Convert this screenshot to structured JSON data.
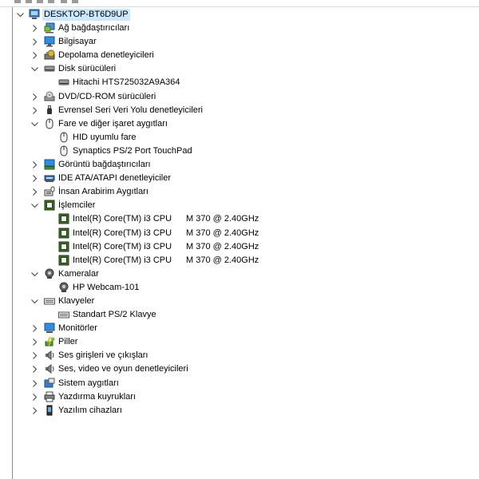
{
  "tree": {
    "root": {
      "label": "DESKTOP-BT6D9UP",
      "icon": "computer-icon"
    },
    "items": [
      {
        "label": "Ağ bağdaştırıcıları",
        "icon": "network-adapter-icon",
        "expanded": false,
        "children": []
      },
      {
        "label": "Bilgisayar",
        "icon": "computer-monitor-icon",
        "expanded": false,
        "children": []
      },
      {
        "label": "Depolama denetleyicileri",
        "icon": "storage-controller-icon",
        "expanded": false,
        "children": []
      },
      {
        "label": "Disk sürücüleri",
        "icon": "disk-drive-icon",
        "expanded": true,
        "children": [
          {
            "label": "Hitachi HTS725032A9A364",
            "icon": "disk-drive-icon"
          }
        ]
      },
      {
        "label": "DVD/CD-ROM sürücüleri",
        "icon": "dvd-drive-icon",
        "expanded": false,
        "children": []
      },
      {
        "label": "Evrensel Seri Veri Yolu denetleyicileri",
        "icon": "usb-icon",
        "expanded": false,
        "children": []
      },
      {
        "label": "Fare ve diğer işaret aygıtları",
        "icon": "mouse-icon",
        "expanded": true,
        "children": [
          {
            "label": "HID uyumlu fare",
            "icon": "mouse-icon"
          },
          {
            "label": "Synaptics PS/2 Port TouchPad",
            "icon": "mouse-icon"
          }
        ]
      },
      {
        "label": "Görüntü bağdaştırıcıları",
        "icon": "display-adapter-icon",
        "expanded": false,
        "children": []
      },
      {
        "label": "IDE ATA/ATAPI denetleyiciler",
        "icon": "ide-controller-icon",
        "expanded": false,
        "children": []
      },
      {
        "label": "İnsan Arabirim Aygıtları",
        "icon": "hid-icon",
        "expanded": false,
        "children": []
      },
      {
        "label": "İşlemciler",
        "icon": "processor-icon",
        "expanded": true,
        "children": [
          {
            "label": "Intel(R) Core(TM) i3 CPU",
            "label2": "M 370  @ 2.40GHz",
            "icon": "processor-icon"
          },
          {
            "label": "Intel(R) Core(TM) i3 CPU",
            "label2": "M 370  @ 2.40GHz",
            "icon": "processor-icon"
          },
          {
            "label": "Intel(R) Core(TM) i3 CPU",
            "label2": "M 370  @ 2.40GHz",
            "icon": "processor-icon"
          },
          {
            "label": "Intel(R) Core(TM) i3 CPU",
            "label2": "M 370  @ 2.40GHz",
            "icon": "processor-icon"
          }
        ]
      },
      {
        "label": "Kameralar",
        "icon": "camera-icon",
        "expanded": true,
        "children": [
          {
            "label": "HP Webcam-101",
            "icon": "camera-icon"
          }
        ]
      },
      {
        "label": "Klavyeler",
        "icon": "keyboard-icon",
        "expanded": true,
        "children": [
          {
            "label": "Standart PS/2 Klavye",
            "icon": "keyboard-icon"
          }
        ]
      },
      {
        "label": "Monitörler",
        "icon": "monitor-icon",
        "expanded": false,
        "children": []
      },
      {
        "label": "Piller",
        "icon": "battery-icon",
        "expanded": false,
        "children": []
      },
      {
        "label": "Ses girişleri ve çıkışları",
        "icon": "speaker-icon",
        "expanded": false,
        "children": []
      },
      {
        "label": "Ses, video ve oyun denetleyicileri",
        "icon": "speaker-icon",
        "expanded": false,
        "children": []
      },
      {
        "label": "Sistem aygıtları",
        "icon": "system-device-icon",
        "expanded": false,
        "children": []
      },
      {
        "label": "Yazdırma kuyrukları",
        "icon": "printer-icon",
        "expanded": false,
        "children": []
      },
      {
        "label": "Yazılım cihazları",
        "icon": "software-device-icon",
        "expanded": false,
        "children": []
      }
    ]
  },
  "colors": {
    "selection": "#cce8ff",
    "chevron": "#444444",
    "border": "#8f8f8f"
  }
}
